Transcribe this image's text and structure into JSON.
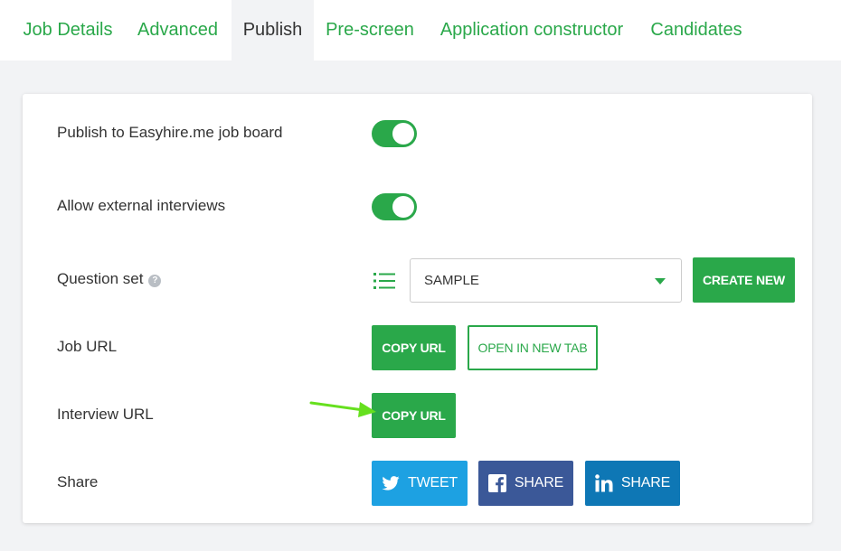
{
  "tabs": [
    {
      "label": "Job Details"
    },
    {
      "label": "Advanced"
    },
    {
      "label": "Publish",
      "active": true
    },
    {
      "label": "Pre-screen"
    },
    {
      "label": "Application constructor"
    },
    {
      "label": "Candidates"
    }
  ],
  "settings": {
    "publish_label": "Publish to Easyhire.me job board",
    "publish_on": true,
    "external_label": "Allow external interviews",
    "external_on": true,
    "question_set_label": "Question set",
    "question_set_help": "?",
    "question_set_value": "SAMPLE",
    "create_new_label": "CREATE NEW",
    "job_url_label": "Job URL",
    "job_copy_label": "COPY URL",
    "open_new_tab_label": "OPEN IN NEW TAB",
    "interview_url_label": "Interview URL",
    "interview_copy_label": "COPY URL",
    "share_label": "Share"
  },
  "share": {
    "twitter": "TWEET",
    "facebook": "SHARE",
    "linkedin": "SHARE"
  },
  "colors": {
    "accent": "#2aa84a",
    "twitter": "#1da1e2",
    "facebook": "#3b5898",
    "linkedin": "#0e77b5",
    "arrow": "#66e01e"
  },
  "icons": [
    "help-icon",
    "list-icon",
    "caret-down-icon",
    "twitter-icon",
    "facebook-icon",
    "linkedin-icon",
    "pointer-arrow-icon"
  ]
}
